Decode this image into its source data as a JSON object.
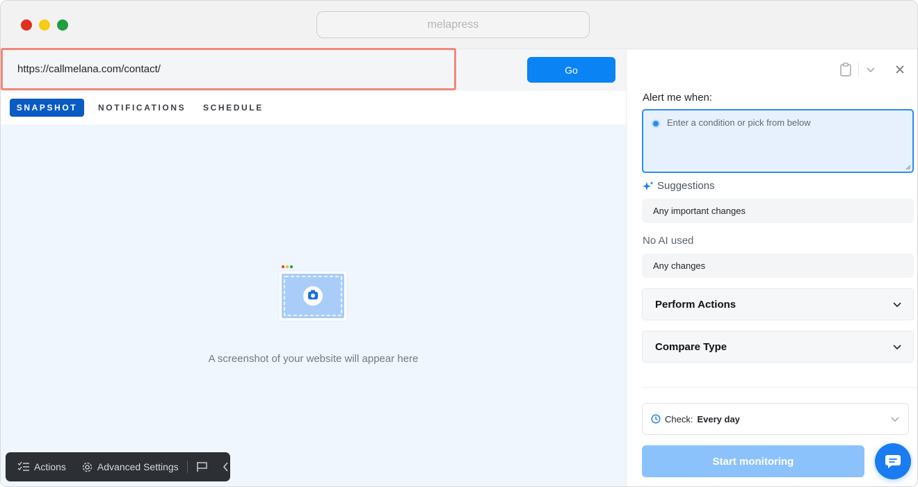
{
  "window": {
    "address": "melapress"
  },
  "url_bar": {
    "value": "https://callmelana.com/contact/",
    "go_label": "Go"
  },
  "tabs": [
    {
      "label": "SNAPSHOT",
      "active": true
    },
    {
      "label": "NOTIFICATIONS",
      "active": false
    },
    {
      "label": "SCHEDULE",
      "active": false
    }
  ],
  "preview": {
    "placeholder_text": "A screenshot of your website will appear here"
  },
  "toolbar": {
    "actions_label": "Actions",
    "advanced_label": "Advanced Settings"
  },
  "panel": {
    "alert_label": "Alert me when:",
    "condition_placeholder": "Enter a condition or pick from below",
    "suggestions_label": "Suggestions",
    "suggestion_1": "Any important changes",
    "no_ai_label": "No AI used",
    "no_ai_option": "Any changes",
    "perform_actions_label": "Perform Actions",
    "compare_type_label": "Compare Type",
    "check_label": "Check:",
    "check_value": "Every day",
    "start_label": "Start monitoring"
  },
  "colors": {
    "accent": "#0a84f5",
    "tab_active": "#0a5bc4",
    "url_highlight": "#f2877a",
    "start_disabled": "#8cc2fb",
    "toolbar_bg": "#2c2f33"
  }
}
